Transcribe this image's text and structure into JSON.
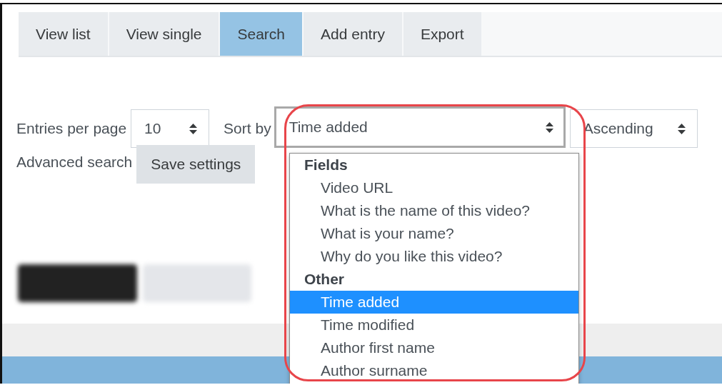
{
  "tabs": [
    {
      "label": "View list",
      "selected": false
    },
    {
      "label": "View single",
      "selected": false
    },
    {
      "label": "Search",
      "selected": true
    },
    {
      "label": "Add entry",
      "selected": false
    },
    {
      "label": "Export",
      "selected": false
    }
  ],
  "entries_per_page": {
    "label": "Entries per page",
    "value": "10"
  },
  "sort_by": {
    "label": "Sort by",
    "value": "Time added",
    "expanded": true
  },
  "order": {
    "value": "Ascending"
  },
  "advanced_search": {
    "label": "Advanced search"
  },
  "save_settings_button": {
    "label": "Save settings"
  },
  "sort_options": [
    {
      "group": "Fields",
      "options": [
        {
          "label": "Video URL",
          "selected": false
        },
        {
          "label": "What is the name of this video?",
          "selected": false
        },
        {
          "label": "What is your name?",
          "selected": false
        },
        {
          "label": "Why do you like this video?",
          "selected": false
        }
      ]
    },
    {
      "group": "Other",
      "options": [
        {
          "label": "Time added",
          "selected": true
        },
        {
          "label": "Time modified",
          "selected": false
        },
        {
          "label": "Author first name",
          "selected": false
        },
        {
          "label": "Author surname",
          "selected": false
        }
      ]
    }
  ],
  "blurred_buttons": [
    {
      "kind": "dark"
    },
    {
      "kind": "light"
    }
  ],
  "annotation": {
    "kind": "outline"
  }
}
